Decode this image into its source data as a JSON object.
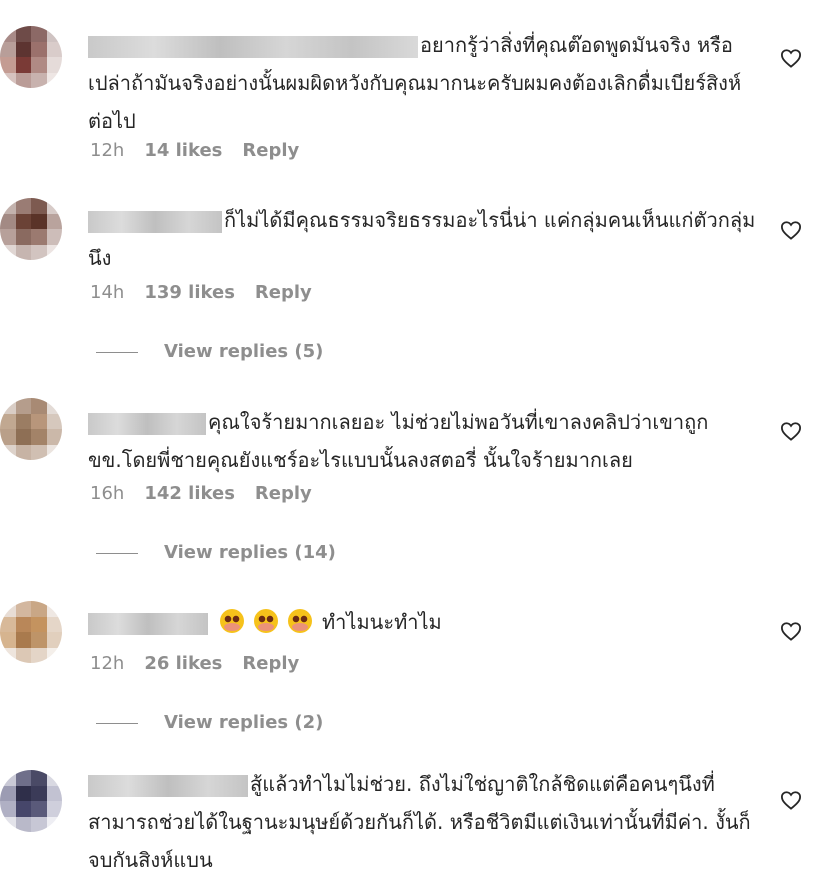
{
  "comments": [
    {
      "text": "อยากรู้ว่าสิ่งที่คุณต๊อดพูดมันจริง หรือเปล่าถ้ามันจริงอย่างนั้นผมผิดหวังกับคุณมากนะครับผมคงต้องเลิกดื่มเบียร์สิงห์ต่อไป",
      "time": "12h",
      "likes": "14 likes",
      "reply": "Reply"
    },
    {
      "text": "ก็ไม่ได้มีคุณธรรมจริยธรรมอะไรนี่น่า แค่กลุ่มคนเห็นแก่ตัวกลุ่มนึง",
      "time": "14h",
      "likes": "139 likes",
      "reply": "Reply",
      "view_replies": "View replies (5)"
    },
    {
      "text": "คุณใจร้ายมากเลยอะ ไม่ช่วยไม่พอวันที่เขาลงคลิปว่าเขาถูกขข.โดยพี่ชายคุณยังแชร์อะไรแบบนั้นลงสตอรี่ นั้นใจร้ายมากเลย",
      "time": "16h",
      "likes": "142 likes",
      "reply": "Reply",
      "view_replies": "View replies (14)"
    },
    {
      "text": "ทำไมนะทำไม",
      "time": "12h",
      "likes": "26 likes",
      "reply": "Reply",
      "view_replies": "View replies (2)"
    },
    {
      "text": "สู้แล้วทำไมไม่ช่วย. ถึงไม่ใช่ญาติใกล้ชิดแต่คือคนๆนึงที่สามารถช่วยได้ในฐานะมนุษย์ด้วยกันก็ได้. หรือชีวิตมีแต่เงินเท่านั้นที่มีค่า. งั้นก็จบกันสิงห์แบน"
    }
  ],
  "colors": {
    "meta": "#8e8e8e",
    "text": "#262626",
    "emoji": "#f6c21b"
  },
  "icons": {
    "like": "heart-icon",
    "reaction": "sad-emoji-icon"
  }
}
